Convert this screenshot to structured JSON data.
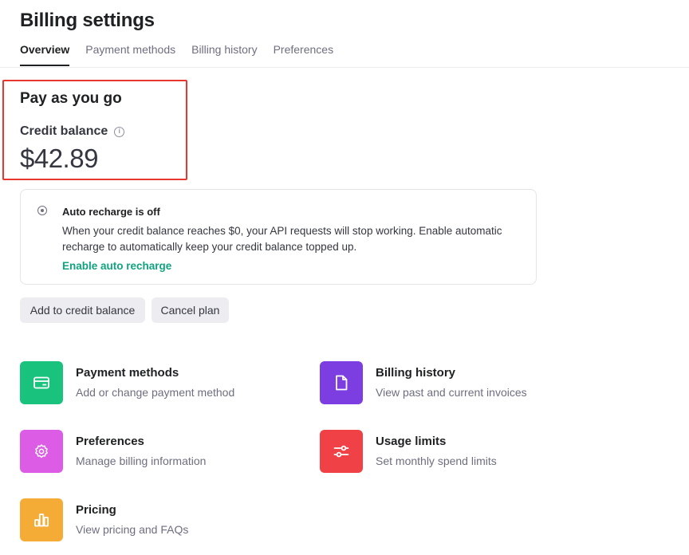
{
  "header": {
    "title": "Billing settings",
    "tabs": [
      {
        "label": "Overview",
        "active": true
      },
      {
        "label": "Payment methods",
        "active": false
      },
      {
        "label": "Billing history",
        "active": false
      },
      {
        "label": "Preferences",
        "active": false
      }
    ]
  },
  "plan": {
    "title": "Pay as you go",
    "credit_label": "Credit balance",
    "credit_amount": "$42.89"
  },
  "recharge": {
    "title": "Auto recharge is off",
    "description": "When your credit balance reaches $0, your API requests will stop working. Enable automatic recharge to automatically keep your credit balance topped up.",
    "link": "Enable auto recharge"
  },
  "buttons": {
    "add": "Add to credit balance",
    "cancel": "Cancel plan"
  },
  "links": [
    {
      "title": "Payment methods",
      "subtitle": "Add or change payment method",
      "icon": "credit-card-icon",
      "color": "#19c37d"
    },
    {
      "title": "Billing history",
      "subtitle": "View past and current invoices",
      "icon": "document-icon",
      "color": "#7c3ee0"
    },
    {
      "title": "Preferences",
      "subtitle": "Manage billing information",
      "icon": "gear-icon",
      "color": "#dd5ce5"
    },
    {
      "title": "Usage limits",
      "subtitle": "Set monthly spend limits",
      "icon": "sliders-icon",
      "color": "#ef4146"
    },
    {
      "title": "Pricing",
      "subtitle": "View pricing and FAQs",
      "icon": "bar-chart-icon",
      "color": "#f4ac36"
    }
  ],
  "colors": {
    "accent": "#10a37f",
    "highlight": "#e8372e"
  }
}
